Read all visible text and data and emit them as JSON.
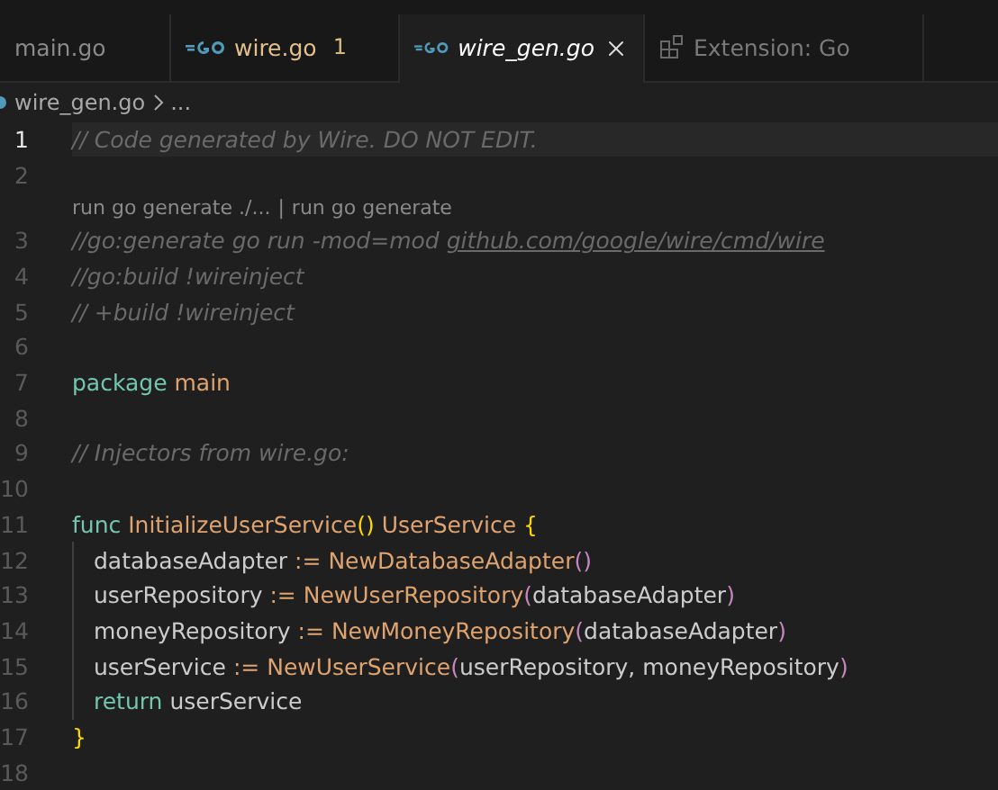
{
  "tabs": [
    {
      "label": "main.go",
      "kind": "plain",
      "selected": false,
      "preview": false
    },
    {
      "label": "wire.go",
      "kind": "go",
      "selected": false,
      "preview": false,
      "badge": "1"
    },
    {
      "label": "wire_gen.go",
      "kind": "go",
      "selected": true,
      "preview": true
    },
    {
      "label": "Extension: Go",
      "kind": "extension",
      "selected": false,
      "preview": false
    }
  ],
  "breadcrumb": {
    "file": "wire_gen.go",
    "more": "..."
  },
  "lines": [
    {
      "kind": "code",
      "number": "1",
      "current": true,
      "tokens": [
        {
          "kind": "comment",
          "text": "// Code generated by Wire. DO NOT EDIT."
        }
      ]
    },
    {
      "kind": "code",
      "number": "2",
      "current": false
    },
    {
      "kind": "codelens",
      "links": [
        "run go generate ./...",
        "run go generate"
      ],
      "separator": "|"
    },
    {
      "kind": "code",
      "number": "3",
      "current": false,
      "tokens": [
        {
          "kind": "comment",
          "text": "//go:generate go run -mod=mod "
        },
        {
          "kind": "link",
          "text": "github.com/google/wire/cmd/wire"
        }
      ]
    },
    {
      "kind": "code",
      "number": "4",
      "current": false,
      "tokens": [
        {
          "kind": "comment",
          "text": "//go:build !wireinject"
        }
      ]
    },
    {
      "kind": "code",
      "number": "5",
      "current": false,
      "tokens": [
        {
          "kind": "comment",
          "text": "// +build !wireinject"
        }
      ]
    },
    {
      "kind": "code",
      "number": "6",
      "current": false
    },
    {
      "kind": "code",
      "number": "7",
      "current": false,
      "tokens": [
        {
          "kind": "keyword",
          "text": "package "
        },
        {
          "kind": "name",
          "text": "main"
        }
      ]
    },
    {
      "kind": "code",
      "number": "8",
      "current": false
    },
    {
      "kind": "code",
      "number": "9",
      "current": false,
      "tokens": [
        {
          "kind": "comment",
          "text": "// Injectors from wire.go:"
        }
      ]
    },
    {
      "kind": "code",
      "number": "10",
      "current": false
    },
    {
      "kind": "code",
      "number": "11",
      "current": false,
      "tokens": [
        {
          "kind": "keyword",
          "text": "func "
        },
        {
          "kind": "name",
          "text": "InitializeUserService"
        },
        {
          "kind": "bracket",
          "text": "()"
        },
        {
          "kind": "name",
          "text": " UserService "
        },
        {
          "kind": "bracket",
          "text": "{"
        }
      ]
    },
    {
      "kind": "code",
      "number": "12",
      "current": false,
      "indented": true,
      "tokens": [
        {
          "kind": "plain",
          "text": "databaseAdapter "
        },
        {
          "kind": "operator",
          "text": ":= "
        },
        {
          "kind": "name",
          "text": "NewDatabaseAdapter"
        },
        {
          "kind": "paren",
          "text": "()"
        }
      ]
    },
    {
      "kind": "code",
      "number": "13",
      "current": false,
      "indented": true,
      "tokens": [
        {
          "kind": "plain",
          "text": "userRepository "
        },
        {
          "kind": "operator",
          "text": ":= "
        },
        {
          "kind": "name",
          "text": "NewUserRepository"
        },
        {
          "kind": "paren",
          "text": "("
        },
        {
          "kind": "plain",
          "text": "databaseAdapter"
        },
        {
          "kind": "paren",
          "text": ")"
        }
      ]
    },
    {
      "kind": "code",
      "number": "14",
      "current": false,
      "indented": true,
      "tokens": [
        {
          "kind": "plain",
          "text": "moneyRepository "
        },
        {
          "kind": "operator",
          "text": ":= "
        },
        {
          "kind": "name",
          "text": "NewMoneyRepository"
        },
        {
          "kind": "paren",
          "text": "("
        },
        {
          "kind": "plain",
          "text": "databaseAdapter"
        },
        {
          "kind": "paren",
          "text": ")"
        }
      ]
    },
    {
      "kind": "code",
      "number": "15",
      "current": false,
      "indented": true,
      "tokens": [
        {
          "kind": "plain",
          "text": "userService "
        },
        {
          "kind": "operator",
          "text": ":= "
        },
        {
          "kind": "name",
          "text": "NewUserService"
        },
        {
          "kind": "paren",
          "text": "("
        },
        {
          "kind": "plain",
          "text": "userRepository, moneyRepository"
        },
        {
          "kind": "paren",
          "text": ")"
        }
      ]
    },
    {
      "kind": "code",
      "number": "16",
      "current": false,
      "indented": true,
      "tokens": [
        {
          "kind": "keyword",
          "text": "return "
        },
        {
          "kind": "plain",
          "text": "userService"
        }
      ]
    },
    {
      "kind": "code",
      "number": "17",
      "current": false,
      "tokens": [
        {
          "kind": "bracket",
          "text": "}"
        }
      ]
    },
    {
      "kind": "code",
      "number": "18",
      "current": false
    }
  ]
}
